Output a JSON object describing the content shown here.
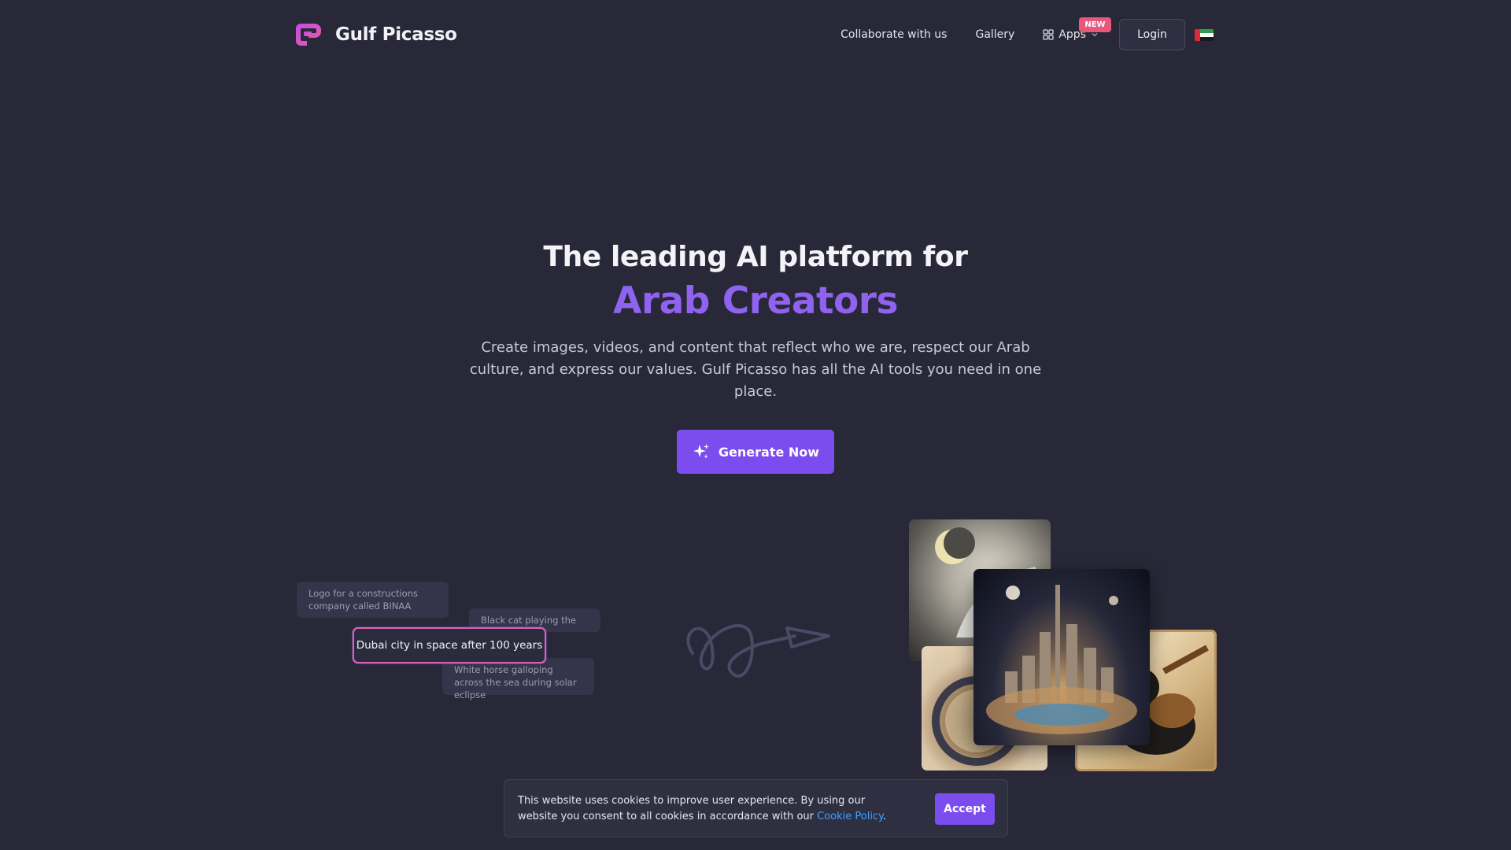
{
  "brand": {
    "name": "Gulf Picasso",
    "accent": "#8f63f0",
    "button_color": "#7b4cee"
  },
  "nav": {
    "collaborate": "Collaborate with us",
    "gallery": "Gallery",
    "apps": "Apps",
    "apps_badge": "NEW",
    "login": "Login",
    "language_flag": "uae-flag-icon"
  },
  "hero": {
    "title": "The leading AI platform for",
    "accent": "Arab Creators",
    "subtitle": "Create images, videos, and content that reflect who we are, respect our Arab culture, and express our values. Gulf Picasso has all the AI tools you need in one place.",
    "cta": "Generate Now"
  },
  "prompts": {
    "items": [
      "Logo for a constructions company called BINAA",
      "Black cat playing the Oud",
      "Dubai city in space after 100 years",
      "White horse galloping across the sea during solar eclipse"
    ],
    "active_index": 2
  },
  "gallery": {
    "images": [
      "white-horse-eclipse-image",
      "binaa-logo-image",
      "dubai-space-city-image",
      "black-cat-oud-image"
    ]
  },
  "cookie": {
    "text": "This website uses cookies to improve user experience. By using our website you consent to all cookies in accordance with our ",
    "link": "Cookie Policy",
    "after": ".",
    "accept": "Accept"
  }
}
